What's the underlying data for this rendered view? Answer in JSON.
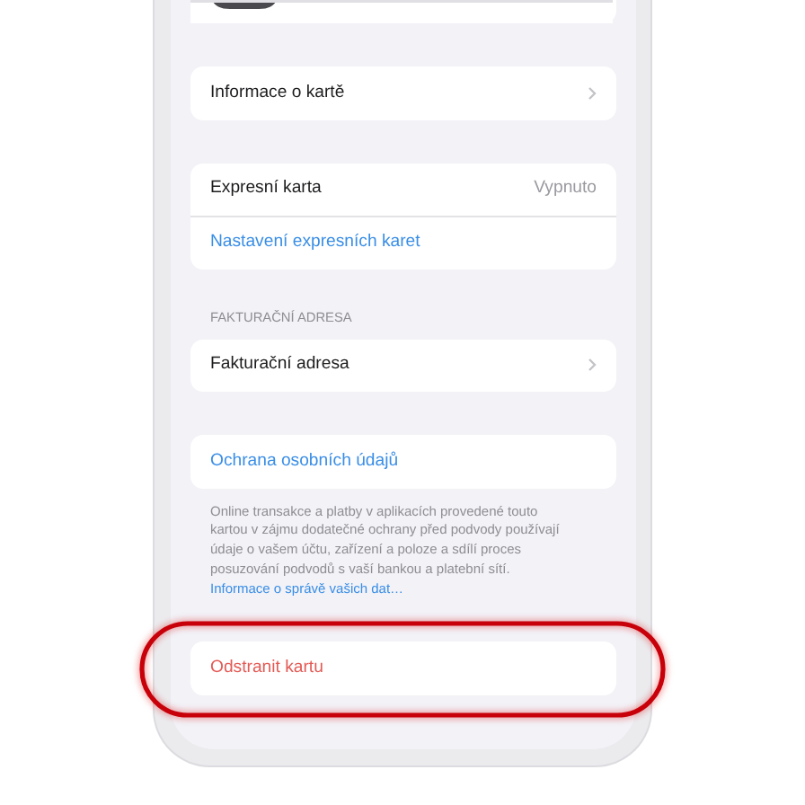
{
  "groups": [
    {
      "rows": [
        {
          "kind": "nav",
          "label": "Informace o kartě"
        }
      ]
    },
    {
      "rows": [
        {
          "kind": "value",
          "label": "Expresní karta",
          "value": "Vypnuto"
        },
        {
          "kind": "link",
          "label": "Nastavení expresních karet"
        }
      ]
    },
    {
      "header": "FAKTURAČNÍ ADRESA",
      "rows": [
        {
          "kind": "nav",
          "label": "Fakturační adresa"
        }
      ]
    },
    {
      "rows": [
        {
          "kind": "link",
          "label": "Ochrana osobních údajů"
        }
      ],
      "footer": {
        "text": "Online transakce a platby v aplikacích provedené touto kartou v zájmu dodatečné ochrany před podvody používají údaje o vašem účtu, zařízení a poloze a sdílí proces posuzování podvodů s vaší bankou a platební sítí.",
        "link": "Informace o správě vašich dat…"
      }
    },
    {
      "rows": [
        {
          "kind": "destructive",
          "label": "Odstranit kartu"
        }
      ],
      "highlighted": true
    }
  ]
}
